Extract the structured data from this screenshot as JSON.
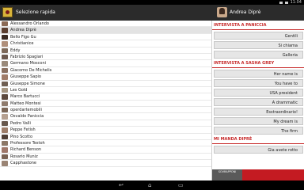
{
  "statusbar": {
    "time": "11:04"
  },
  "appbar": {
    "title": "Selezione rapida"
  },
  "detail": {
    "title": "Andrea Diprè",
    "sections": [
      {
        "heading": "INTERVISTA A PANICCIA",
        "phrases": [
          "Gentili",
          "Si chiama",
          "Galleria"
        ]
      },
      {
        "heading": "INTERVISTA A SASHA GREY",
        "phrases": [
          "Her name is",
          "You have to",
          "USA president",
          "A drammatic",
          "Esstraordinario!",
          "My dream is",
          "The firm"
        ]
      },
      {
        "heading": "MI MANDA DIPRÈ",
        "phrases": [
          "Gia avete rotto"
        ]
      }
    ]
  },
  "list": {
    "items": [
      {
        "label": "Alessandro Orlando",
        "color": "#8b6a55"
      },
      {
        "label": "Andrea Diprè",
        "color": "#5c3f30",
        "selected": true
      },
      {
        "label": "Bello Figo Gu",
        "color": "#3a2a22"
      },
      {
        "label": "Christianice",
        "color": "#b08f7a"
      },
      {
        "label": "Eddy",
        "color": "#7e6a5a"
      },
      {
        "label": "Fabrizio Spagiari",
        "color": "#6d5a4f"
      },
      {
        "label": "Germano Mosconi",
        "color": "#9a8a7a"
      },
      {
        "label": "Giacomo De Michelis",
        "color": "#8a7060"
      },
      {
        "label": "Giuseppe Sapio",
        "color": "#a07c68"
      },
      {
        "label": "Giuseppe Simone",
        "color": "#6f5f52"
      },
      {
        "label": "Les Gold",
        "color": "#a59580"
      },
      {
        "label": "Marco Bartucci",
        "color": "#5e4a3e"
      },
      {
        "label": "Matteo Montesi",
        "color": "#8f7b6c"
      },
      {
        "label": "operdartemobili",
        "color": "#7b6656"
      },
      {
        "label": "Osvaldo Paniccia",
        "color": "#b5a090"
      },
      {
        "label": "Pedro Valli",
        "color": "#68584c"
      },
      {
        "label": "Peppe Fetish",
        "color": "#9e7e6a"
      },
      {
        "label": "Pino Scotto",
        "color": "#4f3f36"
      },
      {
        "label": "Professore Testoh",
        "color": "#8c7866"
      },
      {
        "label": "Richard Benson",
        "color": "#a0786a"
      },
      {
        "label": "Rosario Muniz",
        "color": "#7a6354"
      },
      {
        "label": "Capphastone",
        "color": "#9a8474"
      }
    ]
  },
  "overlay": {
    "label": "SOVRAPPONI"
  }
}
